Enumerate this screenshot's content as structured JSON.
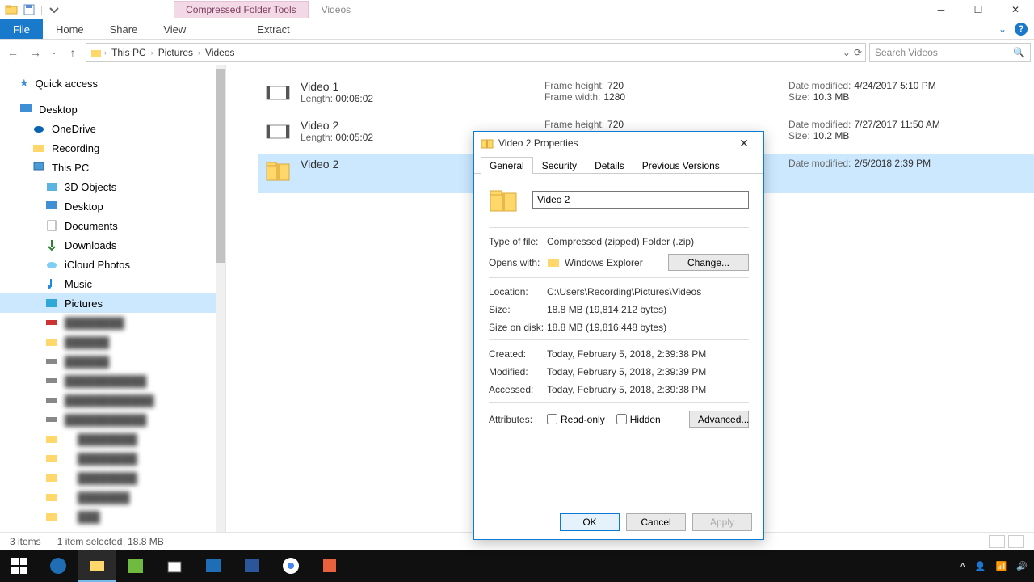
{
  "titlebar": {
    "context_tab": "Compressed Folder Tools",
    "context_sub": "Videos"
  },
  "ribbon": {
    "file": "File",
    "home": "Home",
    "share": "Share",
    "view": "View",
    "extract": "Extract"
  },
  "breadcrumb": {
    "c0": "This PC",
    "c1": "Pictures",
    "c2": "Videos"
  },
  "search": {
    "placeholder": "Search Videos"
  },
  "nav": {
    "quick_access": "Quick access",
    "desktop": "Desktop",
    "onedrive": "OneDrive",
    "recording": "Recording",
    "this_pc": "This PC",
    "objects3d": "3D Objects",
    "desktop2": "Desktop",
    "documents": "Documents",
    "downloads": "Downloads",
    "icloud": "iCloud Photos",
    "music": "Music",
    "pictures": "Pictures",
    "blurred": [
      "████████",
      "██████",
      "██████",
      "███████████",
      "████████████",
      "███████████",
      "████████",
      "████████",
      "████████",
      "███████",
      "███"
    ]
  },
  "files": [
    {
      "name": "Video 1",
      "length_label": "Length:",
      "length": "00:06:02",
      "fh_label": "Frame height:",
      "fh": "720",
      "fw_label": "Frame width:",
      "fw": "1280",
      "dm_label": "Date modified:",
      "dm": "4/24/2017 5:10 PM",
      "sz_label": "Size:",
      "sz": "10.3 MB",
      "type": "video"
    },
    {
      "name": "Video 2",
      "length_label": "Length:",
      "length": "00:05:02",
      "fh_label": "Frame height:",
      "fh": "720",
      "fw_label": "",
      "fw": "",
      "dm_label": "Date modified:",
      "dm": "7/27/2017 11:50 AM",
      "sz_label": "Size:",
      "sz": "10.2 MB",
      "type": "video"
    },
    {
      "name": "Video 2",
      "length_label": "",
      "length": "",
      "fh_label": "",
      "fh": "",
      "fw_label": "",
      "fw": "",
      "dm_label": "Date modified:",
      "dm": "2/5/2018 2:39 PM",
      "sz_label": "",
      "sz": "",
      "type": "zip"
    }
  ],
  "status": {
    "items": "3 items",
    "selected": "1 item selected",
    "size": "18.8 MB"
  },
  "dialog": {
    "title": "Video 2 Properties",
    "tabs": {
      "general": "General",
      "security": "Security",
      "details": "Details",
      "prev": "Previous Versions"
    },
    "name": "Video 2",
    "type_label": "Type of file:",
    "type_val": "Compressed (zipped) Folder (.zip)",
    "opens_label": "Opens with:",
    "opens_val": "Windows Explorer",
    "change": "Change...",
    "loc_label": "Location:",
    "loc_val": "C:\\Users\\Recording\\Pictures\\Videos",
    "size_label": "Size:",
    "size_val": "18.8 MB (19,814,212 bytes)",
    "disk_label": "Size on disk:",
    "disk_val": "18.8 MB (19,816,448 bytes)",
    "created_label": "Created:",
    "created_val": "Today, February 5, 2018, 2:39:38 PM",
    "modified_label": "Modified:",
    "modified_val": "Today, February 5, 2018, 2:39:39 PM",
    "accessed_label": "Accessed:",
    "accessed_val": "Today, February 5, 2018, 2:39:38 PM",
    "attr_label": "Attributes:",
    "readonly": "Read-only",
    "hidden": "Hidden",
    "advanced": "Advanced...",
    "ok": "OK",
    "cancel": "Cancel",
    "apply": "Apply"
  }
}
